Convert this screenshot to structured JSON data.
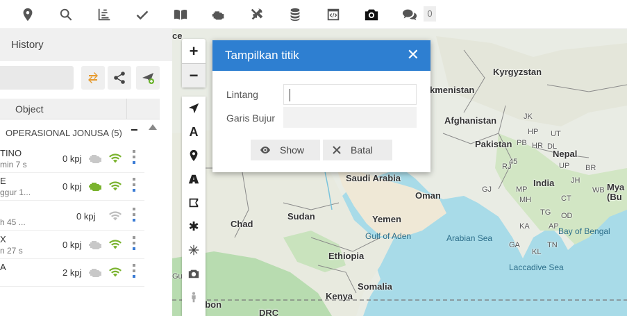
{
  "toolbar": {
    "icons": [
      "map-marker-icon",
      "search-icon",
      "chart-icon",
      "check-icon",
      "book-icon",
      "engine-icon",
      "tools-icon",
      "coins-icon",
      "code-icon",
      "camera-icon",
      "chat-icon"
    ],
    "chat_count": "0"
  },
  "panel": {
    "title": "History",
    "column_object": "Object",
    "group_name": "OPERASIONAL JONUSA (5)",
    "group_collapse": "−",
    "rows": [
      {
        "line1": "TINO",
        "line2": "min 7 s",
        "speed": "0 kpj",
        "engine": "grey",
        "signal": "green"
      },
      {
        "line1": "E",
        "line2": "ggur 1...",
        "speed": "0 kpj",
        "engine": "green",
        "signal": "green"
      },
      {
        "line1": "",
        "line2": "h 45 ...",
        "speed": "0 kpj",
        "engine": "none",
        "signal": "grey"
      },
      {
        "line1": "X",
        "line2": "n 27 s",
        "speed": "0 kpj",
        "engine": "grey",
        "signal": "green"
      },
      {
        "line1": "A",
        "line2": "",
        "speed": "2 kpj",
        "engine": "grey",
        "signal": "green"
      }
    ]
  },
  "map": {
    "places": [
      {
        "name": "Kyrgyzstan",
        "cls": ""
      },
      {
        "name": "kmenistan",
        "cls": ""
      },
      {
        "name": "Afghanistan",
        "cls": ""
      },
      {
        "name": "Pakistan",
        "cls": ""
      },
      {
        "name": "Nepal",
        "cls": ""
      },
      {
        "name": "India",
        "cls": ""
      },
      {
        "name": "Mya",
        "cls": ""
      },
      {
        "name": "(Bu",
        "cls": ""
      },
      {
        "name": "Saudi Arabia",
        "cls": ""
      },
      {
        "name": "Oman",
        "cls": ""
      },
      {
        "name": "Yemen",
        "cls": ""
      },
      {
        "name": "Sudan",
        "cls": ""
      },
      {
        "name": "Chad",
        "cls": ""
      },
      {
        "name": "Ethiopia",
        "cls": ""
      },
      {
        "name": "Somalia",
        "cls": ""
      },
      {
        "name": "Kenya",
        "cls": ""
      },
      {
        "name": "DRC",
        "cls": ""
      },
      {
        "name": "abon",
        "cls": ""
      },
      {
        "name": "Gulf of Aden",
        "cls": "sea"
      },
      {
        "name": "Arabian Sea",
        "cls": "sea"
      },
      {
        "name": "Bay of Bengal",
        "cls": "sea"
      },
      {
        "name": "Laccadive Sea",
        "cls": "sea"
      },
      {
        "name": "HP",
        "cls": "small"
      },
      {
        "name": "PB",
        "cls": "small"
      },
      {
        "name": "UT",
        "cls": "small"
      },
      {
        "name": "HR",
        "cls": "small"
      },
      {
        "name": "DL",
        "cls": "small"
      },
      {
        "name": "RJ",
        "cls": "small"
      },
      {
        "name": "UP",
        "cls": "small"
      },
      {
        "name": "BR",
        "cls": "small"
      },
      {
        "name": "GJ",
        "cls": "small"
      },
      {
        "name": "MP",
        "cls": "small"
      },
      {
        "name": "JH",
        "cls": "small"
      },
      {
        "name": "WB",
        "cls": "small"
      },
      {
        "name": "CT",
        "cls": "small"
      },
      {
        "name": "OD",
        "cls": "small"
      },
      {
        "name": "MH",
        "cls": "small"
      },
      {
        "name": "TG",
        "cls": "small"
      },
      {
        "name": "KA",
        "cls": "small"
      },
      {
        "name": "AP",
        "cls": "small"
      },
      {
        "name": "GA",
        "cls": "small"
      },
      {
        "name": "TN",
        "cls": "small"
      },
      {
        "name": "KL",
        "cls": "small"
      },
      {
        "name": "JK",
        "cls": "small"
      },
      {
        "name": "45",
        "cls": "small"
      },
      {
        "name": "ce",
        "cls": ""
      },
      {
        "name": "Gu",
        "cls": "small"
      }
    ]
  },
  "dialog": {
    "title": "Tampilkan titik",
    "close": "✕",
    "lat_label": "Lintang",
    "lon_label": "Garis Bujur",
    "lat_value": "",
    "lon_value": "",
    "show_label": "Show",
    "cancel_label": "Batal"
  },
  "map_tools": {
    "zoom_in": "+",
    "zoom_out": "−",
    "text_tool": "A",
    "star_tool": "✱"
  }
}
